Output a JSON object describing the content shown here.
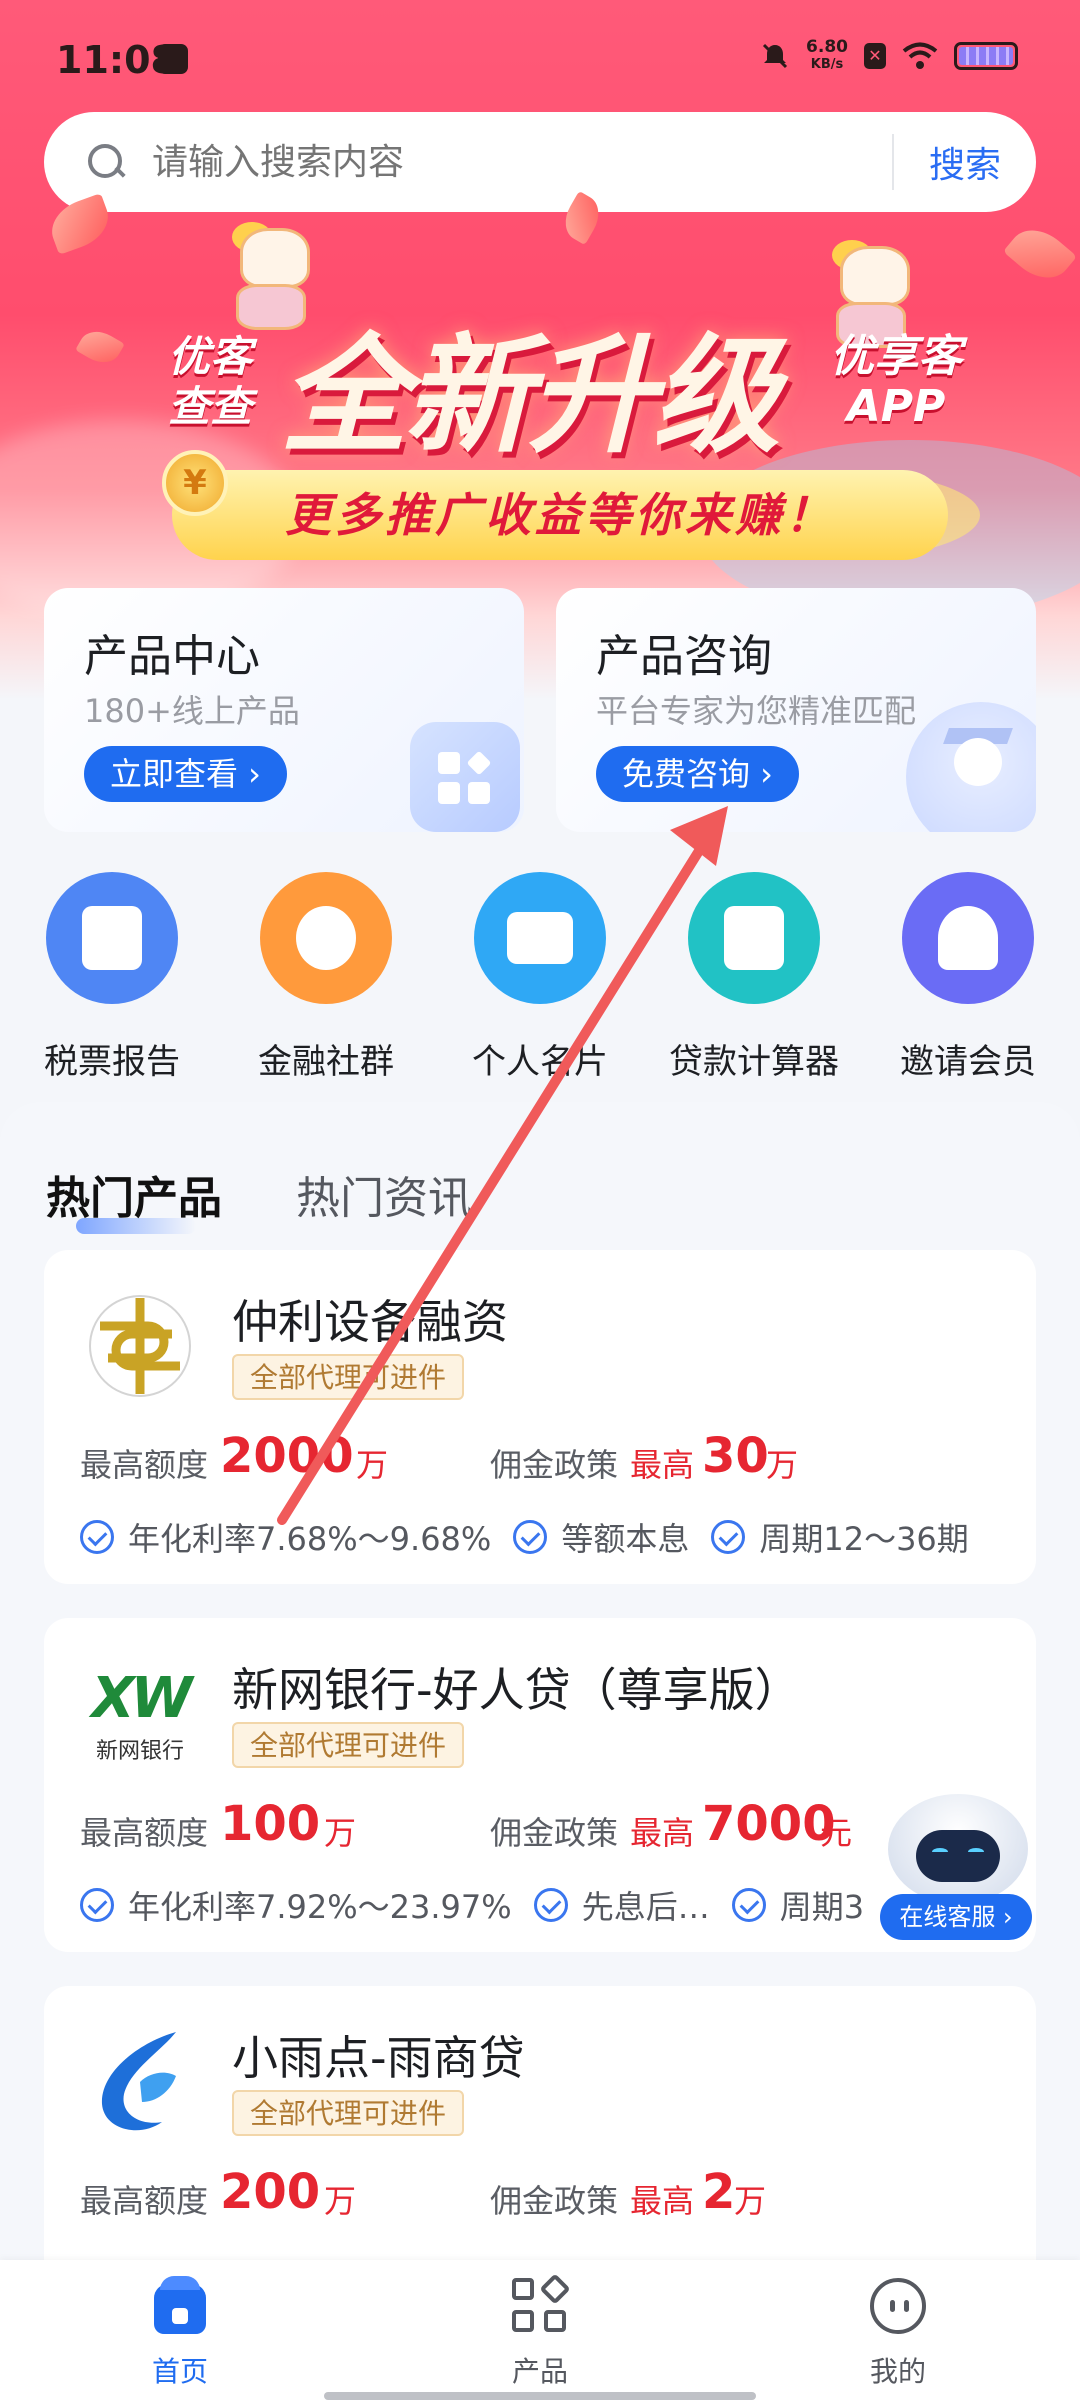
{
  "status_bar": {
    "time": "11:08",
    "net_speed_value": "6.80",
    "net_speed_unit": "KB/s"
  },
  "search": {
    "placeholder": "请输入搜索内容",
    "button_label": "搜索"
  },
  "banner": {
    "left_line1": "优客",
    "left_line2": "查查",
    "main": "全新升级",
    "right_line1": "优享客",
    "right_line2": "APP",
    "slogan": "更多推广收益等你来赚！",
    "coin_symbol": "¥"
  },
  "services": [
    {
      "title": "产品中心",
      "subtitle": "180+线上产品",
      "button": "立即查看 ›"
    },
    {
      "title": "产品咨询",
      "subtitle": "平台专家为您精准匹配",
      "button": "免费咨询 ›"
    }
  ],
  "quick_actions": [
    {
      "label": "税票报告",
      "icon": "tax-report-icon",
      "color": "#4f86f4"
    },
    {
      "label": "金融社群",
      "icon": "finance-community-icon",
      "color": "#ff9a3c"
    },
    {
      "label": "个人名片",
      "icon": "business-card-icon",
      "color": "#2fa8f5"
    },
    {
      "label": "贷款计算器",
      "icon": "calculator-icon",
      "color": "#21c2c5"
    },
    {
      "label": "邀请会员",
      "icon": "invite-member-icon",
      "color": "#6a6cf5"
    }
  ],
  "tabs": [
    {
      "label": "热门产品",
      "active": true
    },
    {
      "label": "热门资讯",
      "active": false
    }
  ],
  "products": [
    {
      "name": "仲利设备融资",
      "tag": "全部代理可进件",
      "limit_label": "最高额度",
      "limit_value": "2000",
      "limit_unit": "万",
      "commission_label": "佣金政策",
      "commission_prefix": "最高",
      "commission_value": "30",
      "commission_unit": "万",
      "features": [
        "年化利率7.68%～9.68%",
        "等额本息",
        "周期12～36期"
      ]
    },
    {
      "name": "新网银行-好人贷（尊享版）",
      "tag": "全部代理可进件",
      "logo_text": "XW",
      "logo_caption": "新网银行",
      "limit_label": "最高额度",
      "limit_value": "100",
      "limit_unit": "万",
      "commission_label": "佣金政策",
      "commission_prefix": "最高",
      "commission_value": "7000",
      "commission_unit": "元",
      "features": [
        "年化利率7.92%～23.97%",
        "先息后…",
        "周期3"
      ]
    },
    {
      "name": "小雨点-雨商贷",
      "tag": "全部代理可进件",
      "limit_label": "最高额度",
      "limit_value": "200",
      "limit_unit": "万",
      "commission_label": "佣金政策",
      "commission_prefix": "最高",
      "commission_value": "2",
      "commission_unit": "万"
    }
  ],
  "customer_service": {
    "label": "在线客服 ›"
  },
  "bottom_nav": [
    {
      "label": "首页",
      "active": true
    },
    {
      "label": "产品",
      "active": false
    },
    {
      "label": "我的",
      "active": false
    }
  ],
  "colors": {
    "brand_blue": "#1f6cf0",
    "accent_red": "#e62631",
    "hero_pink": "#ff5a79",
    "annotation_arrow": "#f05a5a"
  }
}
